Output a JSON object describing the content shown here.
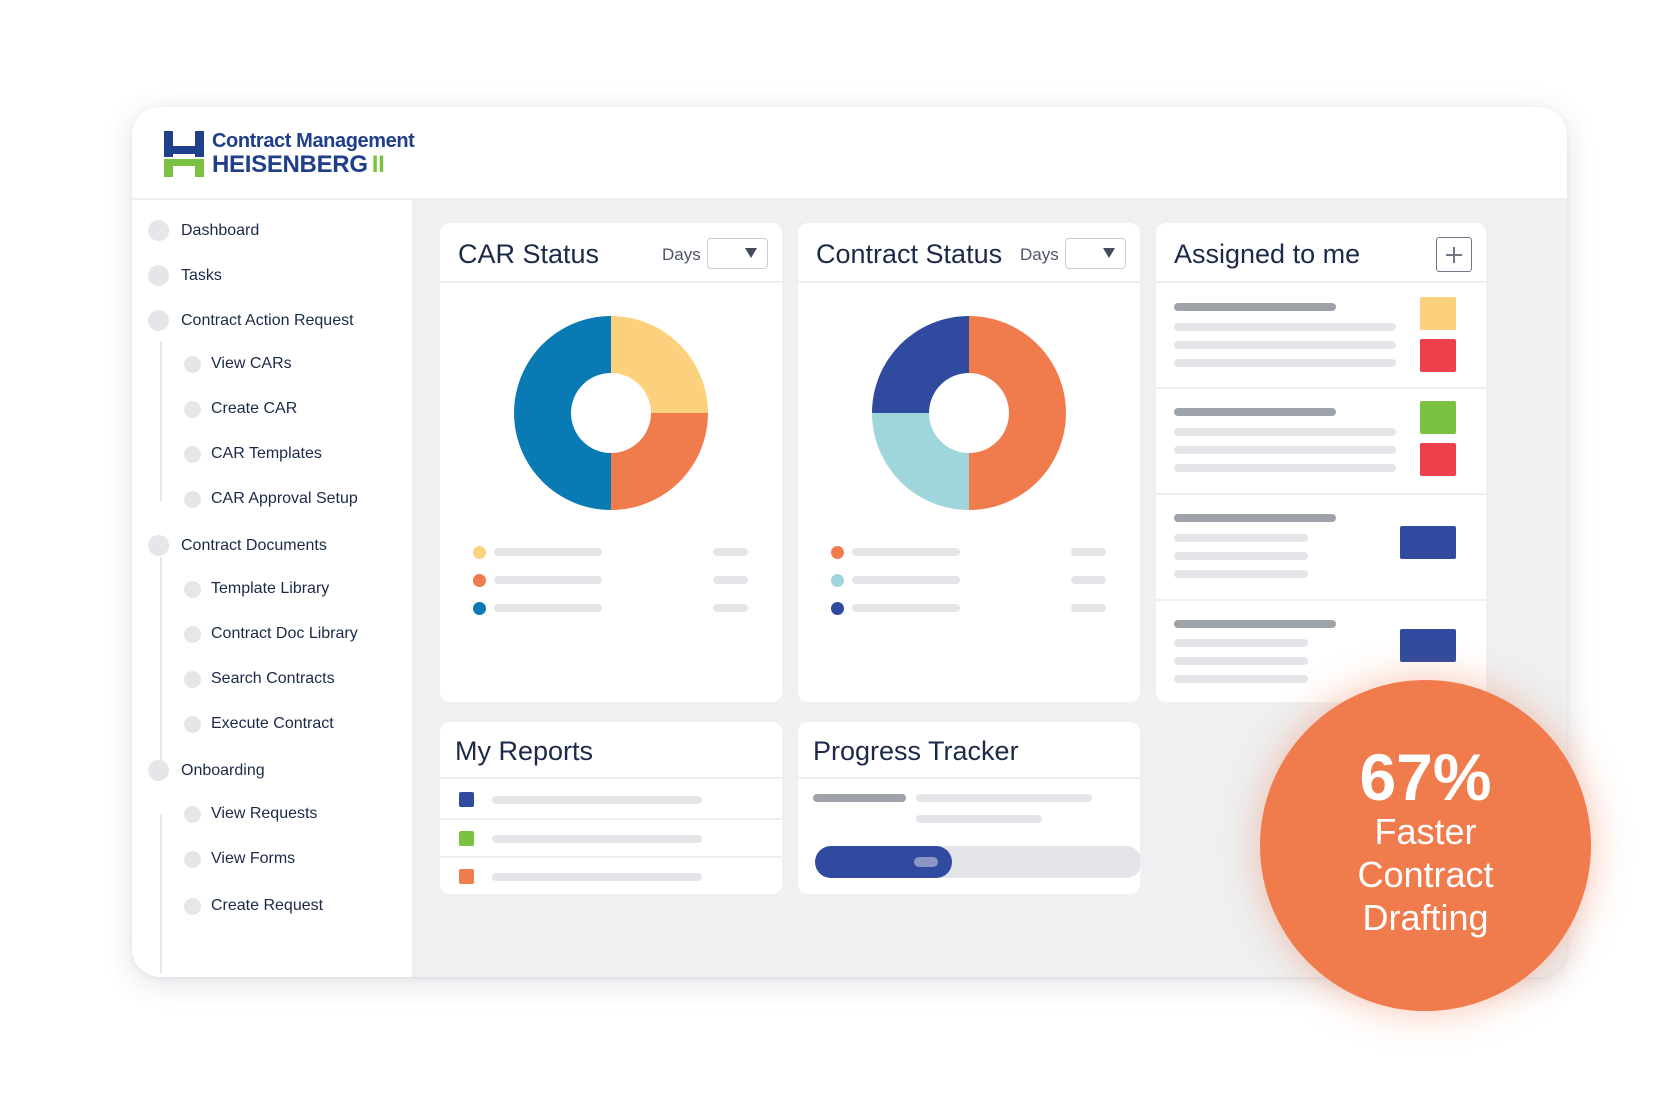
{
  "app": {
    "logo_line1": "Contract Management",
    "logo_line2": "HEISENBERG",
    "logo_roman": "II",
    "brand_blue": "#1f3f8a",
    "brand_green": "#7cc242"
  },
  "sidebar": {
    "items": [
      {
        "label": "Dashboard",
        "level": 0
      },
      {
        "label": "Tasks",
        "level": 0
      },
      {
        "label": "Contract Action Request",
        "level": 0
      },
      {
        "label": "View CARs",
        "level": 1
      },
      {
        "label": "Create CAR",
        "level": 1
      },
      {
        "label": "CAR Templates",
        "level": 1
      },
      {
        "label": "CAR Approval Setup",
        "level": 1
      },
      {
        "label": "Contract Documents",
        "level": 0
      },
      {
        "label": "Template Library",
        "level": 1
      },
      {
        "label": "Contract Doc Library",
        "level": 1
      },
      {
        "label": "Search Contracts",
        "level": 1
      },
      {
        "label": "Execute Contract",
        "level": 1
      },
      {
        "label": "Onboarding",
        "level": 0
      },
      {
        "label": "View Requests",
        "level": 1
      },
      {
        "label": "View Forms",
        "level": 1
      },
      {
        "label": "Create Request",
        "level": 1
      }
    ]
  },
  "car_status": {
    "title": "CAR Status",
    "filter_label": "Days",
    "filter_value": ""
  },
  "contract_status": {
    "title": "Contract Status",
    "filter_label": "Days",
    "filter_value": ""
  },
  "assigned": {
    "title": "Assigned to me",
    "add_icon": "plus-icon"
  },
  "reports": {
    "title": "My Reports",
    "row_colors": [
      "#2f4a9e",
      "#7cc242",
      "#f07b4c"
    ]
  },
  "progress": {
    "title": "Progress Tracker",
    "value": 0.42
  },
  "badge": {
    "percent": "67%",
    "line1": "Faster",
    "line2": "Contract",
    "line3": "Drafting",
    "color": "#f07b4c"
  },
  "chart_data": [
    {
      "type": "pie",
      "title": "CAR Status",
      "slices": [
        {
          "value": 25,
          "color": "#fcd17e"
        },
        {
          "value": 25,
          "color": "#f07b4c"
        },
        {
          "value": 50,
          "color": "#0a7ab5"
        }
      ]
    },
    {
      "type": "pie",
      "title": "Contract Status",
      "slices": [
        {
          "value": 50,
          "color": "#f07b4c"
        },
        {
          "value": 25,
          "color": "#9fd6dc"
        },
        {
          "value": 25,
          "color": "#2f4a9e"
        }
      ]
    }
  ]
}
